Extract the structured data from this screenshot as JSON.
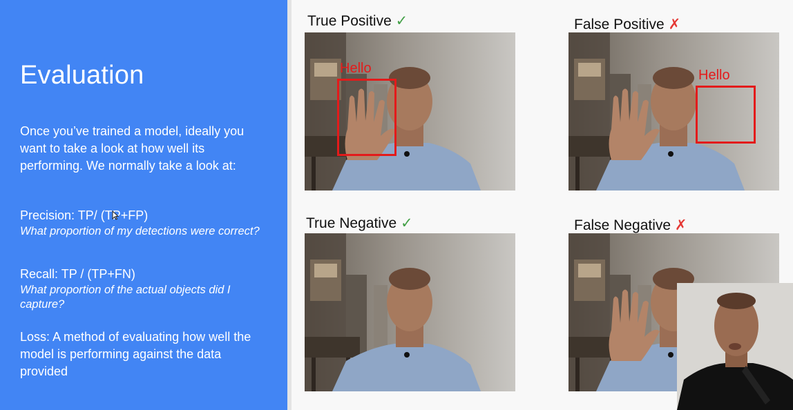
{
  "slide": {
    "title": "Evaluation",
    "intro": "Once you’ve trained a model, ideally you want to take a look at how well its performing. We normally take a look at:",
    "precision_label": "Precision: TP/ (TP+FP)",
    "precision_desc": "What proportion of my detections were correct?",
    "recall_label": "Recall: TP / (TP+FN)",
    "recall_desc": "What proportion of the actual objects did I capture?",
    "loss": "Loss: A method of evaluating how well the model is performing against the data provided"
  },
  "panels": {
    "tp": {
      "caption": "True Positive",
      "mark": "✓",
      "box_label": "Hello"
    },
    "fp": {
      "caption": "False Positive",
      "mark": "✗",
      "box_label": "Hello"
    },
    "tn": {
      "caption": "True Negative",
      "mark": "✓"
    },
    "fn": {
      "caption": "False Negative",
      "mark": "✗"
    }
  },
  "colors": {
    "slide_blue": "#4285f4",
    "box_red": "#e31b1b",
    "check_green": "#43a047",
    "cross_red": "#e53935"
  },
  "icons": {
    "check": "check-icon",
    "cross": "cross-icon"
  }
}
